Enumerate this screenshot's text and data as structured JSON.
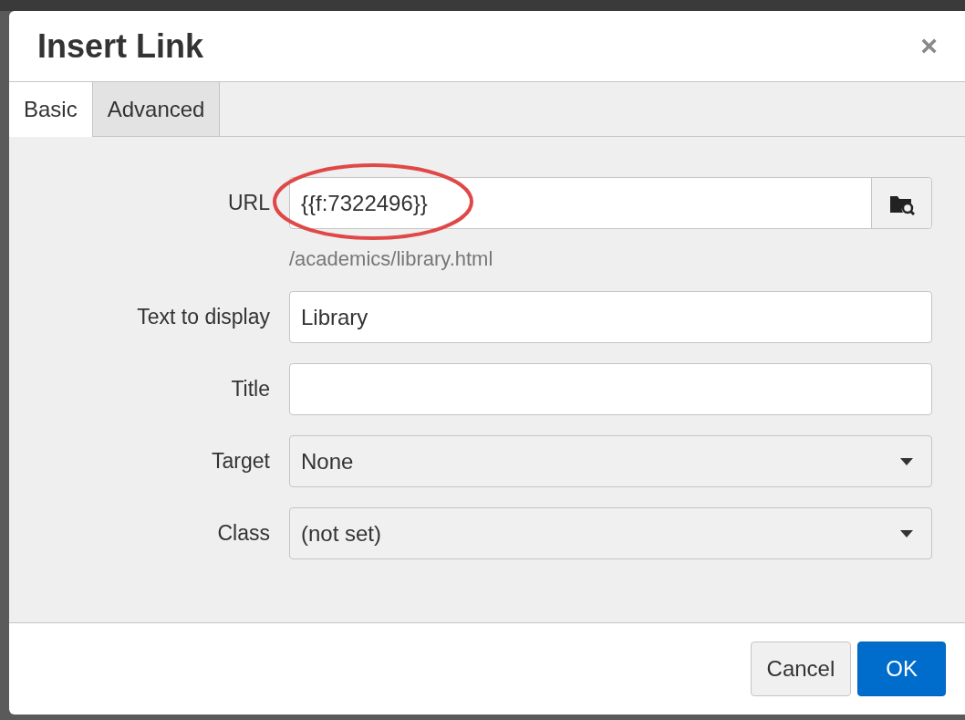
{
  "dialog": {
    "title": "Insert Link",
    "close": "×"
  },
  "tabs": [
    {
      "label": "Basic",
      "selected": true
    },
    {
      "label": "Advanced",
      "selected": false
    }
  ],
  "fields": [
    {
      "kind": "browse",
      "label": "URL",
      "value": "{{f:7322496}}",
      "hint": "/academics/library.html",
      "highlighted": true
    },
    {
      "kind": "text",
      "label": "Text to display",
      "value": "Library"
    },
    {
      "kind": "text",
      "label": "Title"
    },
    {
      "kind": "select",
      "label": "Target",
      "value": "None"
    },
    {
      "kind": "select",
      "label": "Class",
      "value": "(not set)"
    }
  ],
  "buttons": [
    {
      "label": "Cancel",
      "primary": false
    },
    {
      "label": "OK",
      "primary": true
    }
  ]
}
